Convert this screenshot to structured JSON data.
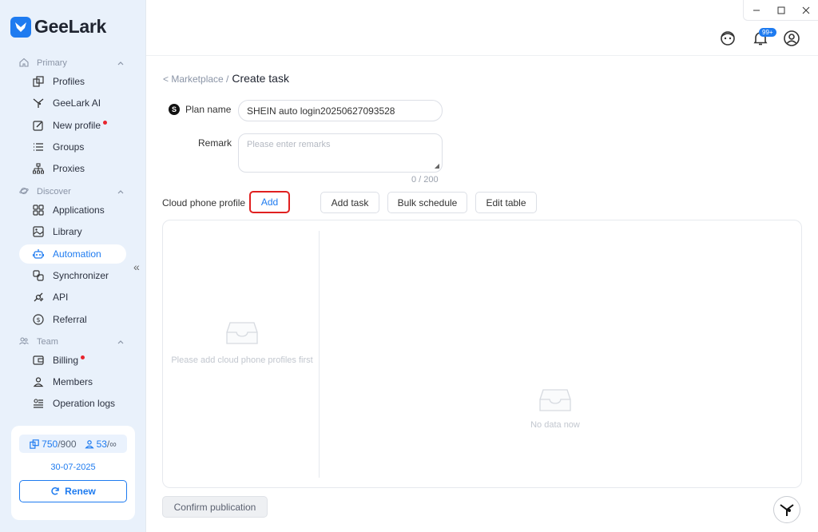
{
  "app": {
    "brand": "GeeLark",
    "accent": "#1e7bf0",
    "alert": "#e8242d"
  },
  "sidebar": {
    "sections": [
      {
        "label": "Primary",
        "icon": "home-icon"
      },
      {
        "label": "Discover",
        "icon": "planet-icon"
      },
      {
        "label": "Team",
        "icon": "team-icon"
      }
    ],
    "items": [
      {
        "label": "Profiles",
        "icon": "profiles-icon"
      },
      {
        "label": "GeeLark AI",
        "icon": "ai-icon"
      },
      {
        "label": "New profile",
        "icon": "edit-icon",
        "dot": true
      },
      {
        "label": "Groups",
        "icon": "list-icon"
      },
      {
        "label": "Proxies",
        "icon": "network-icon"
      },
      {
        "label": "Applications",
        "icon": "grid-icon"
      },
      {
        "label": "Library",
        "icon": "image-icon"
      },
      {
        "label": "Automation",
        "icon": "robot-icon",
        "active": true
      },
      {
        "label": "Synchronizer",
        "icon": "sync-icon"
      },
      {
        "label": "API",
        "icon": "api-icon"
      },
      {
        "label": "Referral",
        "icon": "dollar-icon"
      },
      {
        "label": "Billing",
        "icon": "wallet-icon",
        "dot": true
      },
      {
        "label": "Members",
        "icon": "user-icon"
      },
      {
        "label": "Operation logs",
        "icon": "log-icon"
      }
    ],
    "plan": {
      "profiles_used": "750",
      "profiles_total": "/900",
      "members_used": "53",
      "members_total": "/∞",
      "expiry": "30-07-2025",
      "renew_label": "Renew"
    }
  },
  "topbar": {
    "notification_badge": "99+"
  },
  "breadcrumb": {
    "back": "< Marketplace /",
    "current": "Create task"
  },
  "form": {
    "plan_name_label": "Plan name",
    "plan_name_value": "SHEIN auto login20250627093528",
    "remark_label": "Remark",
    "remark_placeholder": "Please enter remarks",
    "remark_count": "0 / 200",
    "cloud_profile_label": "Cloud phone profile",
    "add_label": "Add",
    "add_task_label": "Add task",
    "bulk_schedule_label": "Bulk schedule",
    "edit_table_label": "Edit table"
  },
  "panel": {
    "left_empty": "Please add cloud phone profiles first",
    "right_empty": "No data now"
  },
  "footer": {
    "confirm_label": "Confirm publication"
  }
}
